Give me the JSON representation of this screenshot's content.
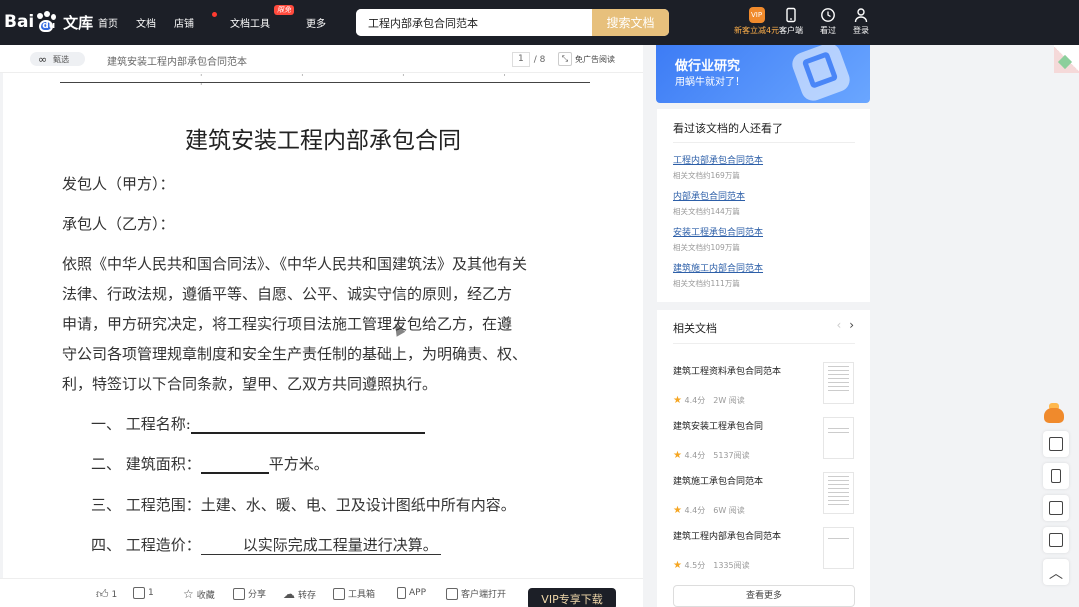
{
  "header": {
    "logo_text": "Bai",
    "logo_du": "du",
    "logo_wenku": "文库",
    "nav": [
      {
        "label": "首页"
      },
      {
        "label": "文档"
      },
      {
        "label": "店铺"
      },
      {
        "label": "文档工具",
        "badge": "限免"
      },
      {
        "label": "更多"
      }
    ],
    "search_value": "工程内部承包合同范本",
    "search_button": "搜索文档",
    "gift_label": "新客立减4元",
    "gift_icon_text": "VIP",
    "client_label": "客户端",
    "history_label": "看过",
    "login_label": "登录"
  },
  "docbar": {
    "chip_label": "甄选",
    "title": "建筑安装工程内部承包合同范本",
    "page_current": "1",
    "page_total": "/ 8",
    "adfree_label": "免广告阅读"
  },
  "document": {
    "title": "建筑安装工程内部承包合同",
    "party_a": "发包人（甲方）：",
    "party_b": "承包人（乙方）：",
    "body_lines": [
      "依照《中华人民共和国合同法》、《中华人民共和国建筑法》及其他有关",
      "法律、行政法规，遵循平等、自愿、公平、诚实守信的原则，经乙方",
      "申请，甲方研究决定，将工程实行项目法施工管理发包给乙方，在遵",
      "守公司各项管理规章制度和安全生产责任制的基础上，为明确责、权、",
      "利，特签订以下合同条款，望甲、乙双方共同遵照执行。"
    ],
    "item1_label": "一、 工程名称:",
    "item2_label": "二、 建筑面积：",
    "item2_unit": "平方米。",
    "item3": "三、 工程范围：土建、水、暖、电、卫及设计图纸中所有内容。",
    "item4_label": "四、 工程造价：",
    "item4_value": "以实际完成工程量进行决算。"
  },
  "toolbar": {
    "like_count": "1",
    "comment_count": "1",
    "favorite": "收藏",
    "share": "分享",
    "save": "转存",
    "toolbox": "工具箱",
    "app": "APP",
    "client_open": "客户端打开",
    "vip_download": "VIP专享下载"
  },
  "ad": {
    "line1": "做行业研究",
    "line2": "用蜗牛就对了！"
  },
  "seen": {
    "title": "看过该文档的人还看了",
    "items": [
      {
        "title": "工程内部承包合同范本",
        "sub": "相关文档约169万篇"
      },
      {
        "title": "内部承包合同范本",
        "sub": "相关文档约144万篇"
      },
      {
        "title": "安装工程承包合同范本",
        "sub": "相关文档约109万篇"
      },
      {
        "title": "建筑施工内部合同范本",
        "sub": "相关文档约111万篇"
      }
    ]
  },
  "related": {
    "title": "相关文档",
    "items": [
      {
        "title": "建筑工程资料承包合同范本",
        "score": "4.4分",
        "reads": "2W 阅读"
      },
      {
        "title": "建筑安装工程承包合同",
        "score": "4.4分",
        "reads": "5137阅读"
      },
      {
        "title": "建筑施工承包合同范本",
        "score": "4.4分",
        "reads": "6W 阅读"
      },
      {
        "title": "建筑工程内部承包合同范本",
        "score": "4.5分",
        "reads": "1335阅读"
      }
    ],
    "more": "查看更多"
  }
}
